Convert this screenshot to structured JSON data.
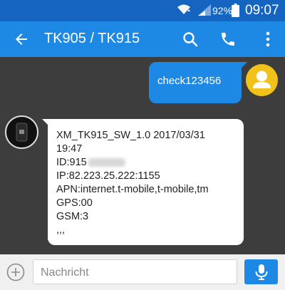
{
  "status_bar": {
    "battery_percent": "92%",
    "time": "09:07"
  },
  "app_bar": {
    "title": "TK905 / TK915"
  },
  "conversation": {
    "outgoing_text": "check123456",
    "incoming_lines": [
      "XM_TK915_SW_1.0 2017/03/31",
      "19:47",
      "ID:915",
      "IP:82.223.25.222:1155",
      "APN:internet.t-mobile,t-mobile,tm",
      "GPS:00",
      "GSM:3",
      ",,,"
    ]
  },
  "composer": {
    "placeholder": "Nachricht"
  },
  "colors": {
    "status_bar": "#1565c0",
    "app_bar": "#1e88e5",
    "conversation_background": "#3d3d3d",
    "avatar": "#f1c21b"
  }
}
